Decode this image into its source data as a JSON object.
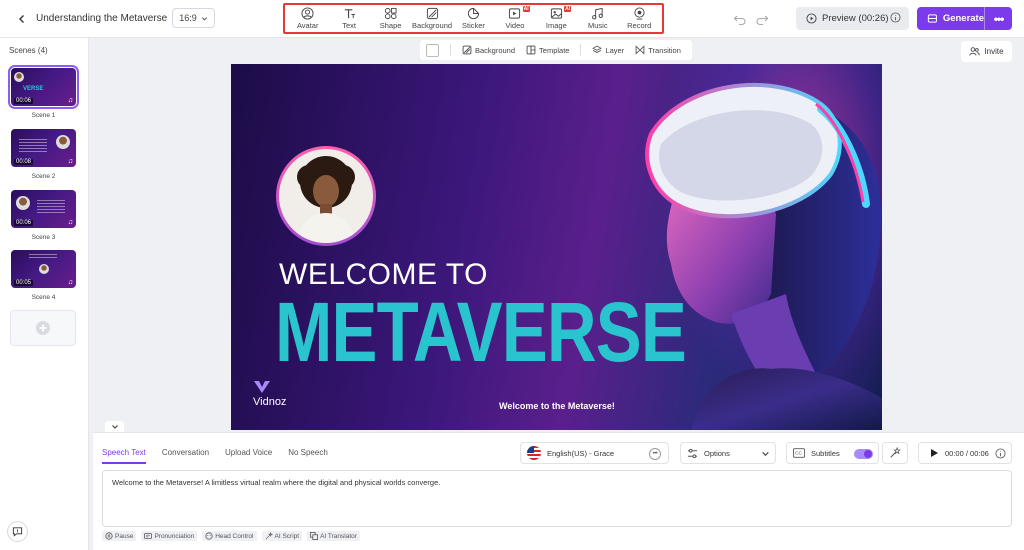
{
  "header": {
    "project_title": "Understanding the Metaverse",
    "aspect_ratio": "16:9",
    "tools": [
      {
        "label": "Avatar",
        "icon": "avatar-icon",
        "ai": false
      },
      {
        "label": "Text",
        "icon": "text-icon",
        "ai": false
      },
      {
        "label": "Shape",
        "icon": "shape-icon",
        "ai": false
      },
      {
        "label": "Background",
        "icon": "background-icon",
        "ai": false
      },
      {
        "label": "Sticker",
        "icon": "sticker-icon",
        "ai": false
      },
      {
        "label": "Video",
        "icon": "video-icon",
        "ai": true
      },
      {
        "label": "Image",
        "icon": "image-icon",
        "ai": true
      },
      {
        "label": "Music",
        "icon": "music-icon",
        "ai": false
      },
      {
        "label": "Record",
        "icon": "record-icon",
        "ai": false
      }
    ],
    "ai_badge": "AI",
    "preview_label": "Preview (00:26)",
    "generate_label": "Generate",
    "accent_color": "#7c3aed"
  },
  "scenes": {
    "title": "Scenes (4)",
    "items": [
      {
        "label": "Scene 1",
        "duration": "00:06",
        "thumb_text": "VERSE",
        "active": true
      },
      {
        "label": "Scene 2",
        "duration": "00:08",
        "thumb_text": "",
        "active": false
      },
      {
        "label": "Scene 3",
        "duration": "00:06",
        "thumb_text": "",
        "active": false
      },
      {
        "label": "Scene 4",
        "duration": "00:05",
        "thumb_text": "",
        "active": false
      }
    ]
  },
  "canvas_toolbar": {
    "background": "Background",
    "template": "Template",
    "layer": "Layer",
    "transition": "Transition"
  },
  "invite_label": "Invite",
  "slide": {
    "welcome": "WELCOME TO",
    "headline": "METAVERSE",
    "logo": "Vidnoz",
    "subtitle": "Welcome to the Metaverse!",
    "headline_color": "#2ac4cf"
  },
  "speech": {
    "tabs": [
      {
        "label": "Speech Text",
        "active": true
      },
      {
        "label": "Conversation",
        "active": false
      },
      {
        "label": "Upload Voice",
        "active": false
      },
      {
        "label": "No Speech",
        "active": false
      }
    ],
    "voice": "English(US) - Grace",
    "options": "Options",
    "subtitles": "Subtitles",
    "subtitles_on": true,
    "time": "00:00 / 00:06",
    "text": "Welcome to the Metaverse! A limitless virtual realm where the digital and physical worlds converge.",
    "tools": [
      {
        "label": "Pause",
        "icon": "pause-icon"
      },
      {
        "label": "Pronunciation",
        "icon": "pronunciation-icon"
      },
      {
        "label": "Head Control",
        "icon": "head-control-icon"
      },
      {
        "label": "AI Script",
        "icon": "ai-script-icon"
      },
      {
        "label": "AI Translator",
        "icon": "ai-translator-icon"
      }
    ]
  }
}
